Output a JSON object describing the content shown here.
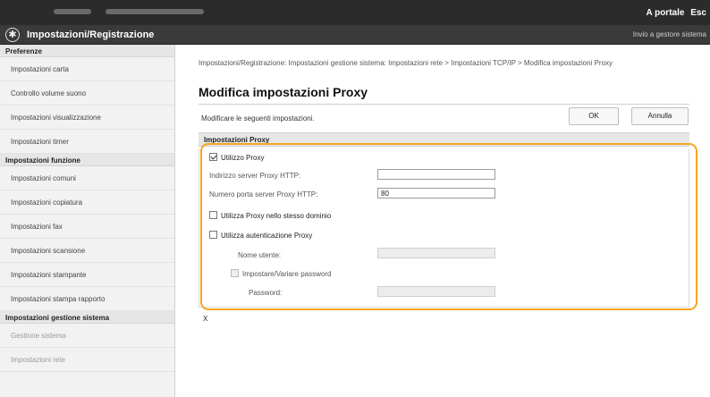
{
  "topbar": {
    "portal_label": "A portale",
    "exit_label": "Esc"
  },
  "header": {
    "title": "Impostazioni/Registrazione",
    "home_link": "Invio a gestore sistema"
  },
  "sidebar": {
    "sections": [
      {
        "heading": "Preferenze",
        "items": [
          "Impostazioni carta",
          "Controllo volume suono",
          "Impostazioni visualizzazione",
          "Impostazioni timer"
        ]
      },
      {
        "heading": "Impostazioni funzione",
        "items": [
          "Impostazioni comuni",
          "Impostazioni copiatura",
          "Impostazioni fax",
          "Impostazioni scansione",
          "Impostazioni stampante",
          "Impostazioni stampa rapporto"
        ]
      },
      {
        "heading": "Impostazioni gestione sistema",
        "items": [
          "Gestione sistema",
          "Impostazioni rete"
        ]
      }
    ]
  },
  "main": {
    "breadcrumb": "Impostazioni/Registrazione: Impostazioni gestione sistema: Impostazioni rete > Impostazioni TCP/IP > Modifica impostazioni Proxy",
    "title": "Modifica impostazioni Proxy",
    "instruction": "Modificare le seguenti impostazioni.",
    "ok_label": "OK",
    "cancel_label": "Annulla",
    "section_title": "Impostazioni Proxy",
    "use_proxy_label": "Utilizzo Proxy",
    "use_proxy_checked": true,
    "http_server_label": "Indirizzo server Proxy HTTP:",
    "http_server_value": "",
    "port_label": "Numero porta server Proxy HTTP:",
    "port_value": "80",
    "same_domain_label": "Utilizza Proxy nello stesso dominio",
    "auth_label": "Utilizza autenticazione Proxy",
    "username_label": "Nome utente:",
    "username_value": "",
    "set_password_label": "Impostare/Variare password",
    "password_label": "Password:",
    "password_value": "",
    "footer_mark": "X"
  },
  "colors": {
    "highlight": "#f5a623",
    "topbar": "#2b2b2b",
    "titlebar": "#3a3a3a"
  }
}
